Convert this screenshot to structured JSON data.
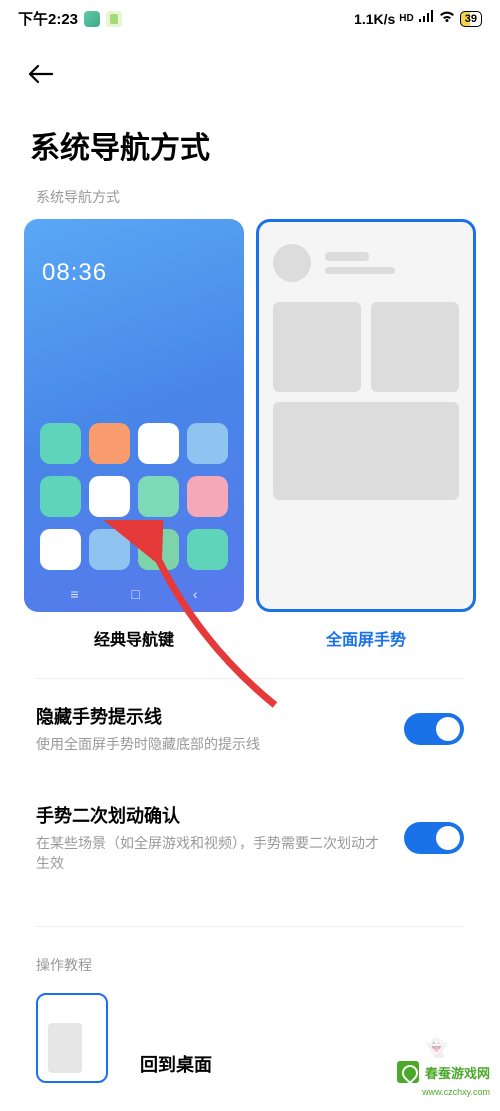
{
  "status_bar": {
    "time": "下午2:23",
    "net_speed": "1.1K/s",
    "hd_label": "HD",
    "battery_level": "39"
  },
  "header": {
    "page_title": "系统导航方式"
  },
  "sections": {
    "nav_mode_label": "系统导航方式",
    "tutorial_label": "操作教程"
  },
  "nav_options": {
    "classic": {
      "label": "经典导航键",
      "selected": false,
      "preview_time": "08:36"
    },
    "gesture": {
      "label": "全面屏手势",
      "selected": true
    }
  },
  "settings": [
    {
      "key": "hide_hint",
      "title": "隐藏手势提示线",
      "desc": "使用全面屏手势时隐藏底部的提示线",
      "enabled": true
    },
    {
      "key": "double_swipe",
      "title": "手势二次划动确认",
      "desc": "在某些场景（如全屏游戏和视频），手势需要二次划动才生效",
      "enabled": true
    }
  ],
  "tutorial": {
    "item1_title": "回到桌面"
  },
  "watermark": {
    "brand": "春蚕游戏网",
    "url": "www.czchxy.com"
  },
  "colors": {
    "accent": "#1a72e8",
    "brand_green": "#4ca82a"
  }
}
